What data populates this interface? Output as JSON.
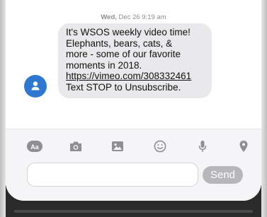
{
  "message": {
    "timestamp_day": "Wed,",
    "timestamp_rest": "Dec 26 9:19 am",
    "lines": [
      "It's WSOS weekly video time!",
      "Elephants, bears, cats, &",
      "more - some of our favorite",
      "moments in 2018.",
      "https://vimeo.com/308332461",
      "Text STOP to Unsubscribe."
    ]
  },
  "composer": {
    "input_value": "",
    "send_label": "Send"
  },
  "icons": {
    "avatar": "person-icon",
    "tools": [
      "text-format-icon",
      "camera-icon",
      "image-icon",
      "emoji-icon",
      "microphone-icon",
      "location-icon"
    ]
  },
  "colors": {
    "avatar": "#2f78d2",
    "bubble": "#e9e9eb",
    "send_button": "#b7b7bb",
    "icon_gray": "#8e8e93"
  }
}
